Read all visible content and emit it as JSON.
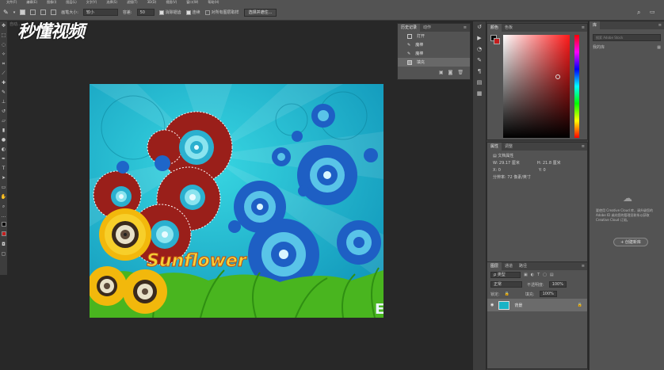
{
  "menu": {
    "items": [
      "文件(F)",
      "编辑(E)",
      "图像(I)",
      "图层(L)",
      "文字(Y)",
      "选择(S)",
      "滤镜(T)",
      "3D(D)",
      "视图(V)",
      "窗口(W)",
      "帮助(H)"
    ]
  },
  "options_bar": {
    "brush_size_label": "画笔大小:",
    "brush_size_value": "较小",
    "tolerance_label": "容差:",
    "tolerance_value": "50",
    "antialias_label": "消除锯齿",
    "contiguous_label": "连续",
    "sample_all_label": "对所有图层取样",
    "select_subject_label": "选择并遮住..."
  },
  "document": {
    "tab_title": "自动..."
  },
  "watermark": {
    "text": "秒懂视频"
  },
  "canvas": {
    "artwork_text": "Sunflower",
    "corner_letter": "E"
  },
  "history": {
    "tabs": [
      "历史记录",
      "动作"
    ],
    "items": [
      {
        "label": "打开",
        "icon": "document-icon"
      },
      {
        "label": "魔棒",
        "icon": "magic-wand-icon"
      },
      {
        "label": "魔棒",
        "icon": "magic-wand-icon"
      },
      {
        "label": "填充",
        "icon": "fill-icon"
      }
    ]
  },
  "color_panel": {
    "tabs": [
      "颜色",
      "色板"
    ],
    "foreground": "#0a0a0a",
    "background": "#c41e1e"
  },
  "properties": {
    "tabs": [
      "属性",
      "调整"
    ],
    "section": "文档属性",
    "w": "W: 29.17 厘米",
    "h": "H: 21.8 厘米",
    "x": "X: 0",
    "y": "Y: 0",
    "resolution": "分辨率: 72 像素/英寸"
  },
  "layers": {
    "tabs": [
      "图层",
      "通道",
      "路径"
    ],
    "kind_label": "ρ 类型",
    "mode": "正常",
    "opacity_label": "不透明度:",
    "opacity_value": "100%",
    "lock_label": "锁定:",
    "fill_label": "填充:",
    "fill_value": "100%",
    "layer_name": "背景"
  },
  "libraries": {
    "tab": "库",
    "search_placeholder": "搜索 Adobe Stock",
    "dropdown": "我的库",
    "message": "要使用 Creative Cloud 库，请升级您的 Adobe ID 或向您的管理员联系以获取 Creative Cloud 订阅。",
    "button": "+ 创建新库"
  }
}
